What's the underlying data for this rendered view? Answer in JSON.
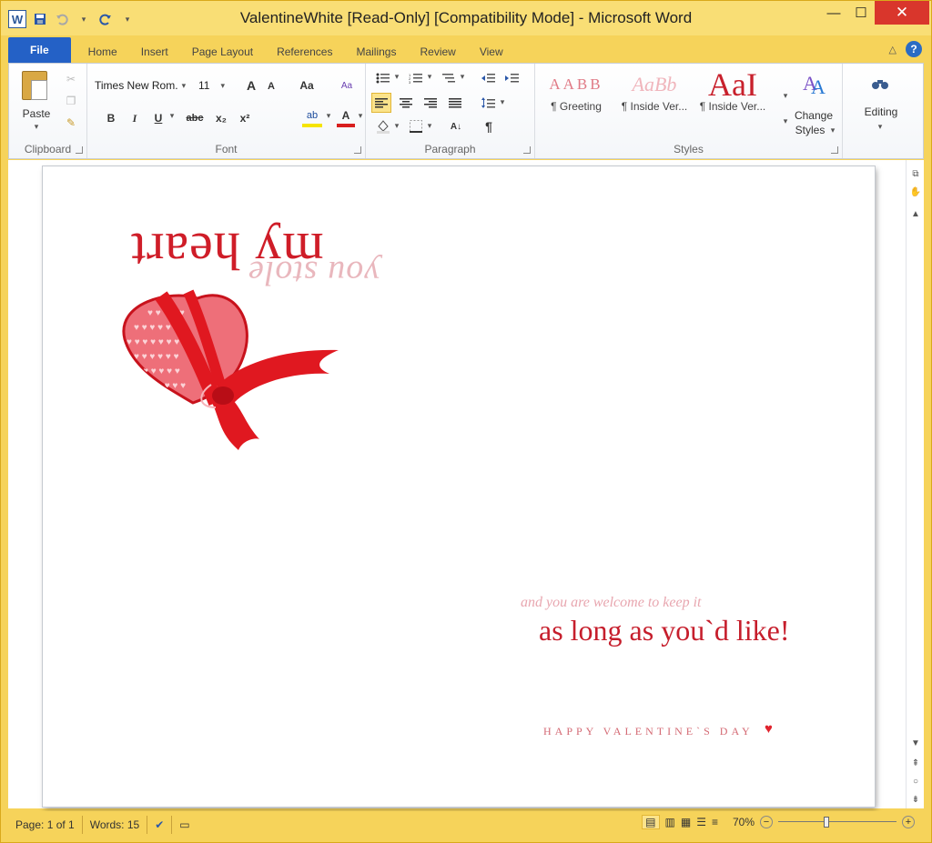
{
  "window": {
    "title": "ValentineWhite [Read-Only] [Compatibility Mode]  -  Microsoft Word",
    "app_icon": "W",
    "minimize": "—",
    "maximize": "☐",
    "close": "✕"
  },
  "qat": {
    "save_icon": "save-icon",
    "undo_icon": "undo-icon",
    "redo_icon": "repeat-icon",
    "customize_icon": "customize-icon"
  },
  "tabs": [
    {
      "label": "File"
    },
    {
      "label": "Home"
    },
    {
      "label": "Insert"
    },
    {
      "label": "Page Layout"
    },
    {
      "label": "References"
    },
    {
      "label": "Mailings"
    },
    {
      "label": "Review"
    },
    {
      "label": "View"
    }
  ],
  "ribbon": {
    "clipboard": {
      "label": "Clipboard",
      "paste": "Paste"
    },
    "font": {
      "label": "Font",
      "font_name": "Times New Rom.",
      "font_size": "11",
      "grow": "A",
      "shrink": "A",
      "change_case": "Aa",
      "bold": "B",
      "italic": "I",
      "underline": "U",
      "strike": "abc",
      "subscript": "x₂",
      "superscript": "x²",
      "highlight": "ab",
      "font_color": "A"
    },
    "paragraph": {
      "label": "Paragraph",
      "pilcrow": "¶"
    },
    "styles": {
      "label": "Styles",
      "items": [
        {
          "sample": "AABB",
          "name": "¶ Greeting"
        },
        {
          "sample": "AaBb",
          "name": "¶ Inside Ver..."
        },
        {
          "sample": "AaI",
          "name": "¶ Inside Ver..."
        }
      ],
      "change_styles": "Change",
      "change_styles_2": "Styles"
    },
    "editing": {
      "label": "Editing"
    }
  },
  "document": {
    "line1": "my heart",
    "line2": "you stole",
    "welcome": "and you are welcome to keep it",
    "aslong": "as long as you`d like!",
    "valentine": "HAPPY VALENTINE`S DAY"
  },
  "status": {
    "page": "Page: 1 of 1",
    "words": "Words: 15",
    "zoom": "70%"
  },
  "colors": {
    "accent": "#2461c6",
    "title_bar": "#f9de75",
    "heart_red": "#cf1d28"
  }
}
